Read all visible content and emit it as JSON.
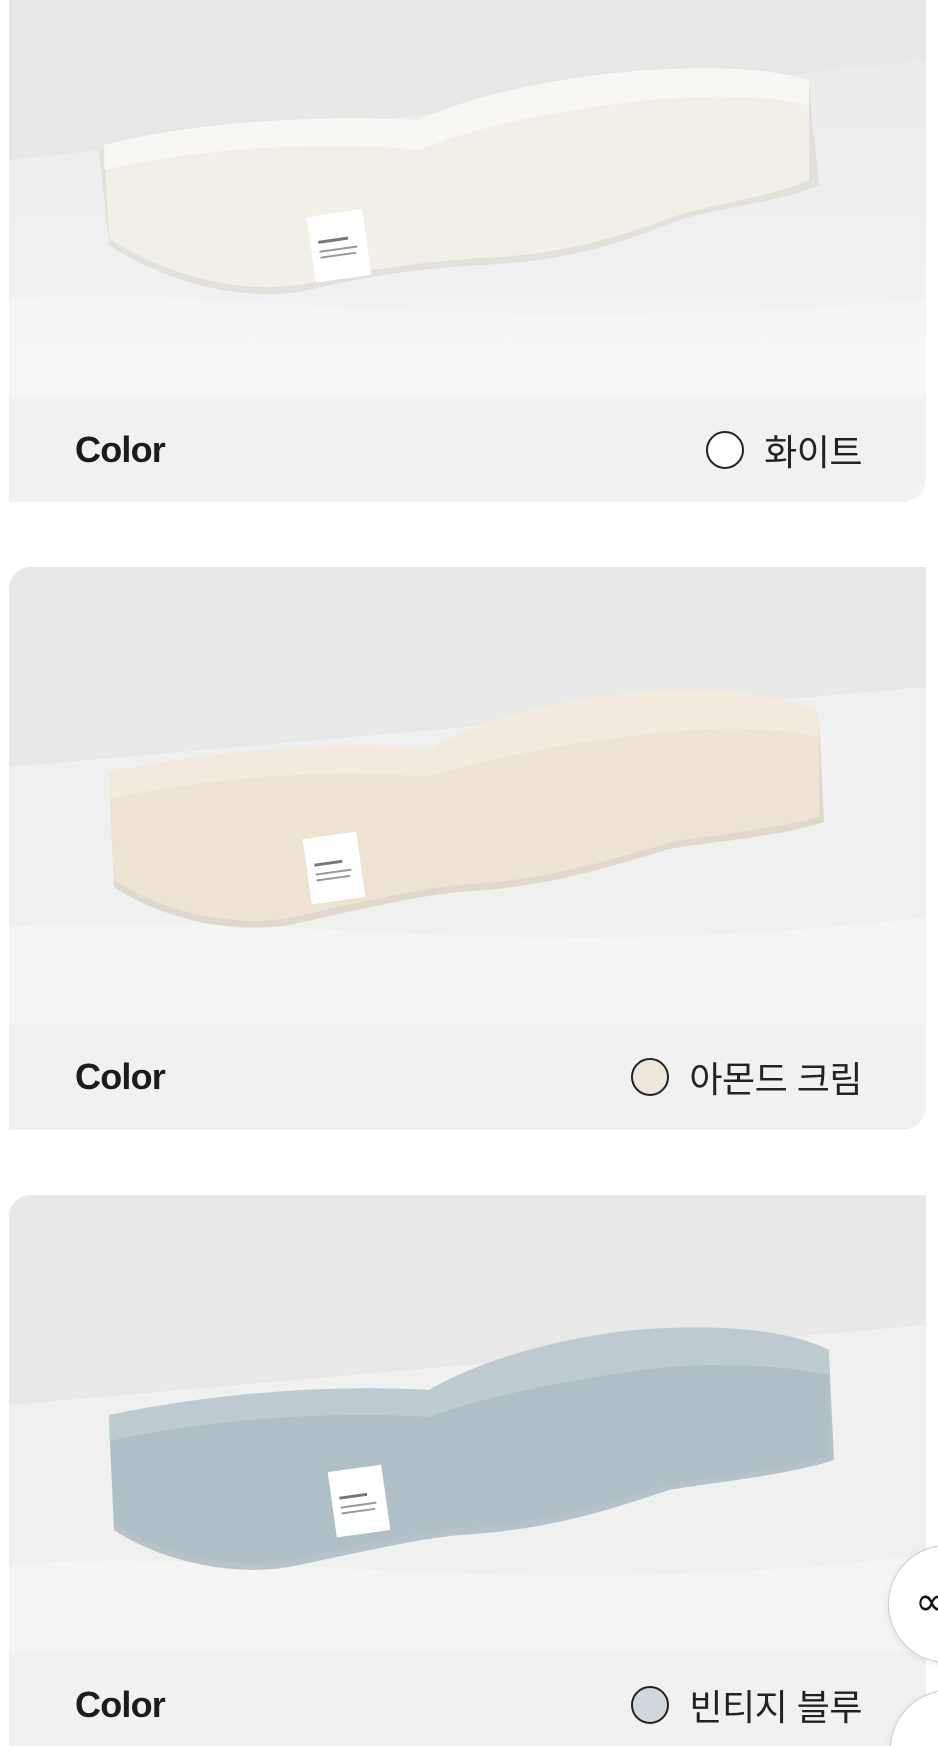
{
  "options": [
    {
      "label": "Color",
      "color_name": "화이트",
      "swatch": "#ffffff",
      "pillow_color": "#f2efe8",
      "pillow_shadow": "#d9d5cc"
    },
    {
      "label": "Color",
      "color_name": "아몬드 크림",
      "swatch": "#efe7de",
      "pillow_color": "#ece3d3",
      "pillow_shadow": "#d4c9b6"
    },
    {
      "label": "Color",
      "color_name": "빈티지 블루",
      "swatch": "#cfd8dc",
      "pillow_color": "#aebfc5",
      "pillow_shadow": "#8fa3ab"
    }
  ],
  "floating_buttons": [
    {
      "icon": "infinity-icon",
      "glyph": "∝"
    },
    {
      "icon": "circle-button-icon",
      "glyph": ""
    }
  ]
}
